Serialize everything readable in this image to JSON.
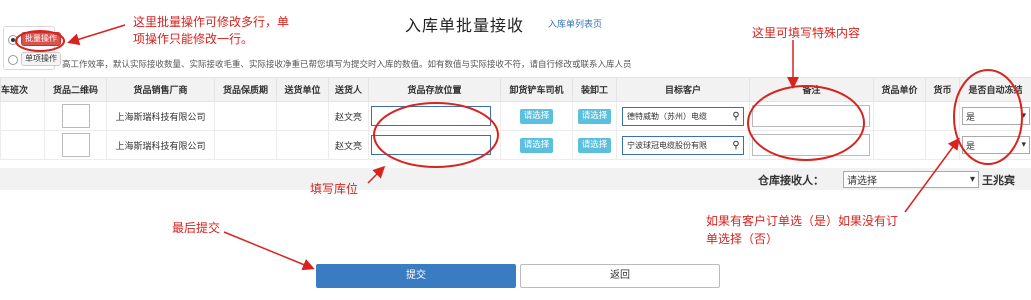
{
  "title": "入库单批量接收",
  "list_link": "入库单列表页",
  "mode": {
    "batch_label": "批量操作",
    "single_label": "单项操作"
  },
  "notice": "高工作效率，默认实际接收数量、实际接收毛重、实际接收净重已帮您填写为提交时入库的数值。如有数值与实际接收不符，请自行修改或联系入库人员",
  "table": {
    "headers": [
      "车班次",
      "货品二维码",
      "货品销售厂商",
      "货品保质期",
      "送货单位",
      "送货人",
      "货品存放位置",
      "卸货铲车司机",
      "装卸工",
      "目标客户",
      "备注",
      "货品单价",
      "货币",
      "是否自动冻结"
    ],
    "rows": [
      {
        "vendor": "上海斯瑞科技有限公司",
        "deliverer": "赵文亮",
        "unloader_btn": "请选择",
        "loader_btn": "请选择",
        "customer": "德特威勒（苏州）电缆",
        "auto_freeze": "是"
      },
      {
        "vendor": "上海斯瑞科技有限公司",
        "deliverer": "赵文亮",
        "unloader_btn": "请选择",
        "loader_btn": "请选择",
        "customer": "宁波球冠电缆股份有限",
        "auto_freeze": "是"
      }
    ]
  },
  "receiver": {
    "label": "仓库接收人：",
    "selected": "请选择",
    "name": "王兆宾"
  },
  "buttons": {
    "submit": "提交",
    "back": "返回"
  },
  "annotations": {
    "batch_note_line1": "这里批量操作可修改多行，单",
    "batch_note_line2": "项操作只能修改一行。",
    "remark_note": "这里可填写特殊内容",
    "location_note": "填写库位",
    "submit_note": "最后提交",
    "freeze_note_line1": "如果有客户订单选（是）如果没有订",
    "freeze_note_line2": "单选择（否）"
  },
  "colors": {
    "annotation": "#d9231f",
    "primary": "#3a7cc1",
    "info": "#5bc0de",
    "danger": "#d9534f"
  }
}
